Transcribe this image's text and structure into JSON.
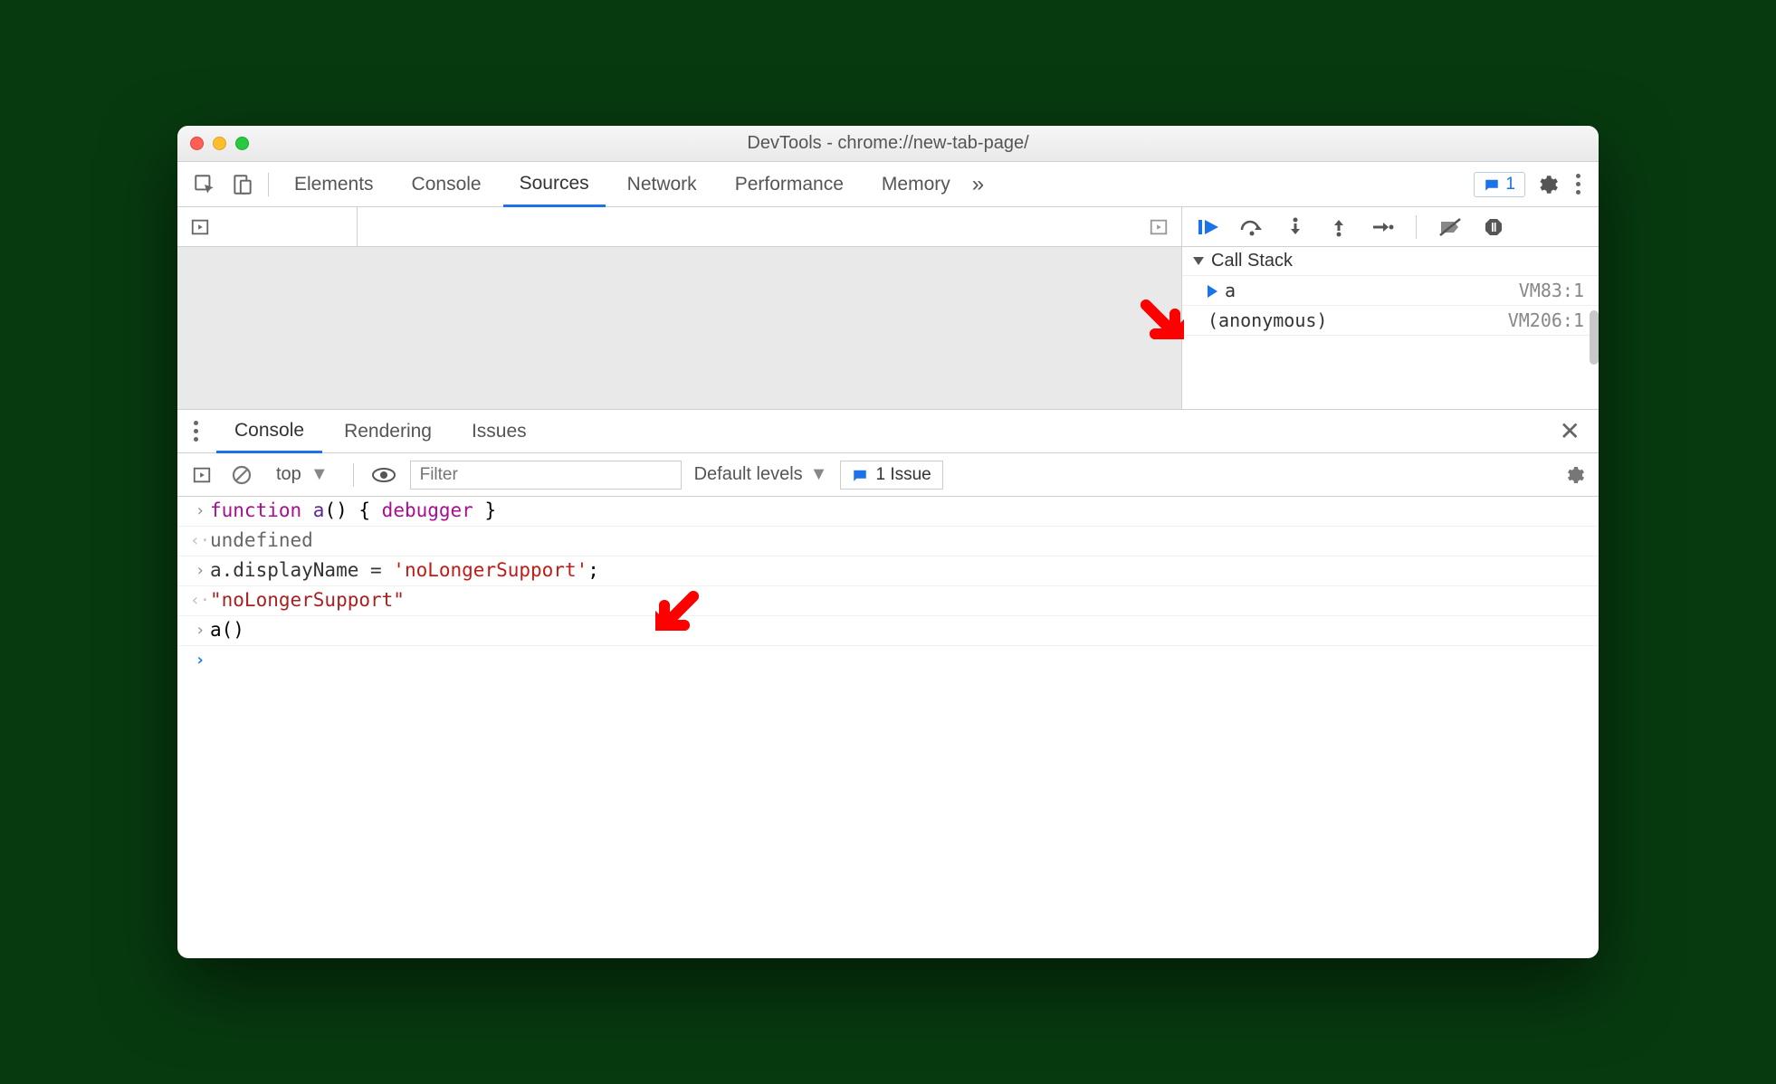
{
  "window": {
    "title": "DevTools - chrome://new-tab-page/"
  },
  "mainTabs": {
    "items": [
      "Elements",
      "Console",
      "Sources",
      "Network",
      "Performance",
      "Memory"
    ],
    "activeIndex": 2,
    "moreGlyph": "»",
    "issueCount": "1"
  },
  "debug": {
    "scope": {
      "label": "Call Stack"
    },
    "stack": [
      {
        "name": "a",
        "loc": "VM83:1",
        "active": true
      },
      {
        "name": "(anonymous)",
        "loc": "VM206:1",
        "active": false
      }
    ]
  },
  "drawer": {
    "tabs": [
      "Console",
      "Rendering",
      "Issues"
    ],
    "activeIndex": 0
  },
  "consoleToolbar": {
    "context": "top",
    "filterPlaceholder": "Filter",
    "levels": "Default levels",
    "issuesLabel": "1 Issue"
  },
  "consoleLines": {
    "l0_kw": "function",
    "l0_fn": " a",
    "l0_rest": "() { ",
    "l0_dbg": "debugger",
    "l0_end": " }",
    "l1": "undefined",
    "l2_a": "a.displayName = ",
    "l2_s": "'noLongerSupport'",
    "l2_e": ";",
    "l3": "\"noLongerSupport\"",
    "l4": "a()"
  }
}
